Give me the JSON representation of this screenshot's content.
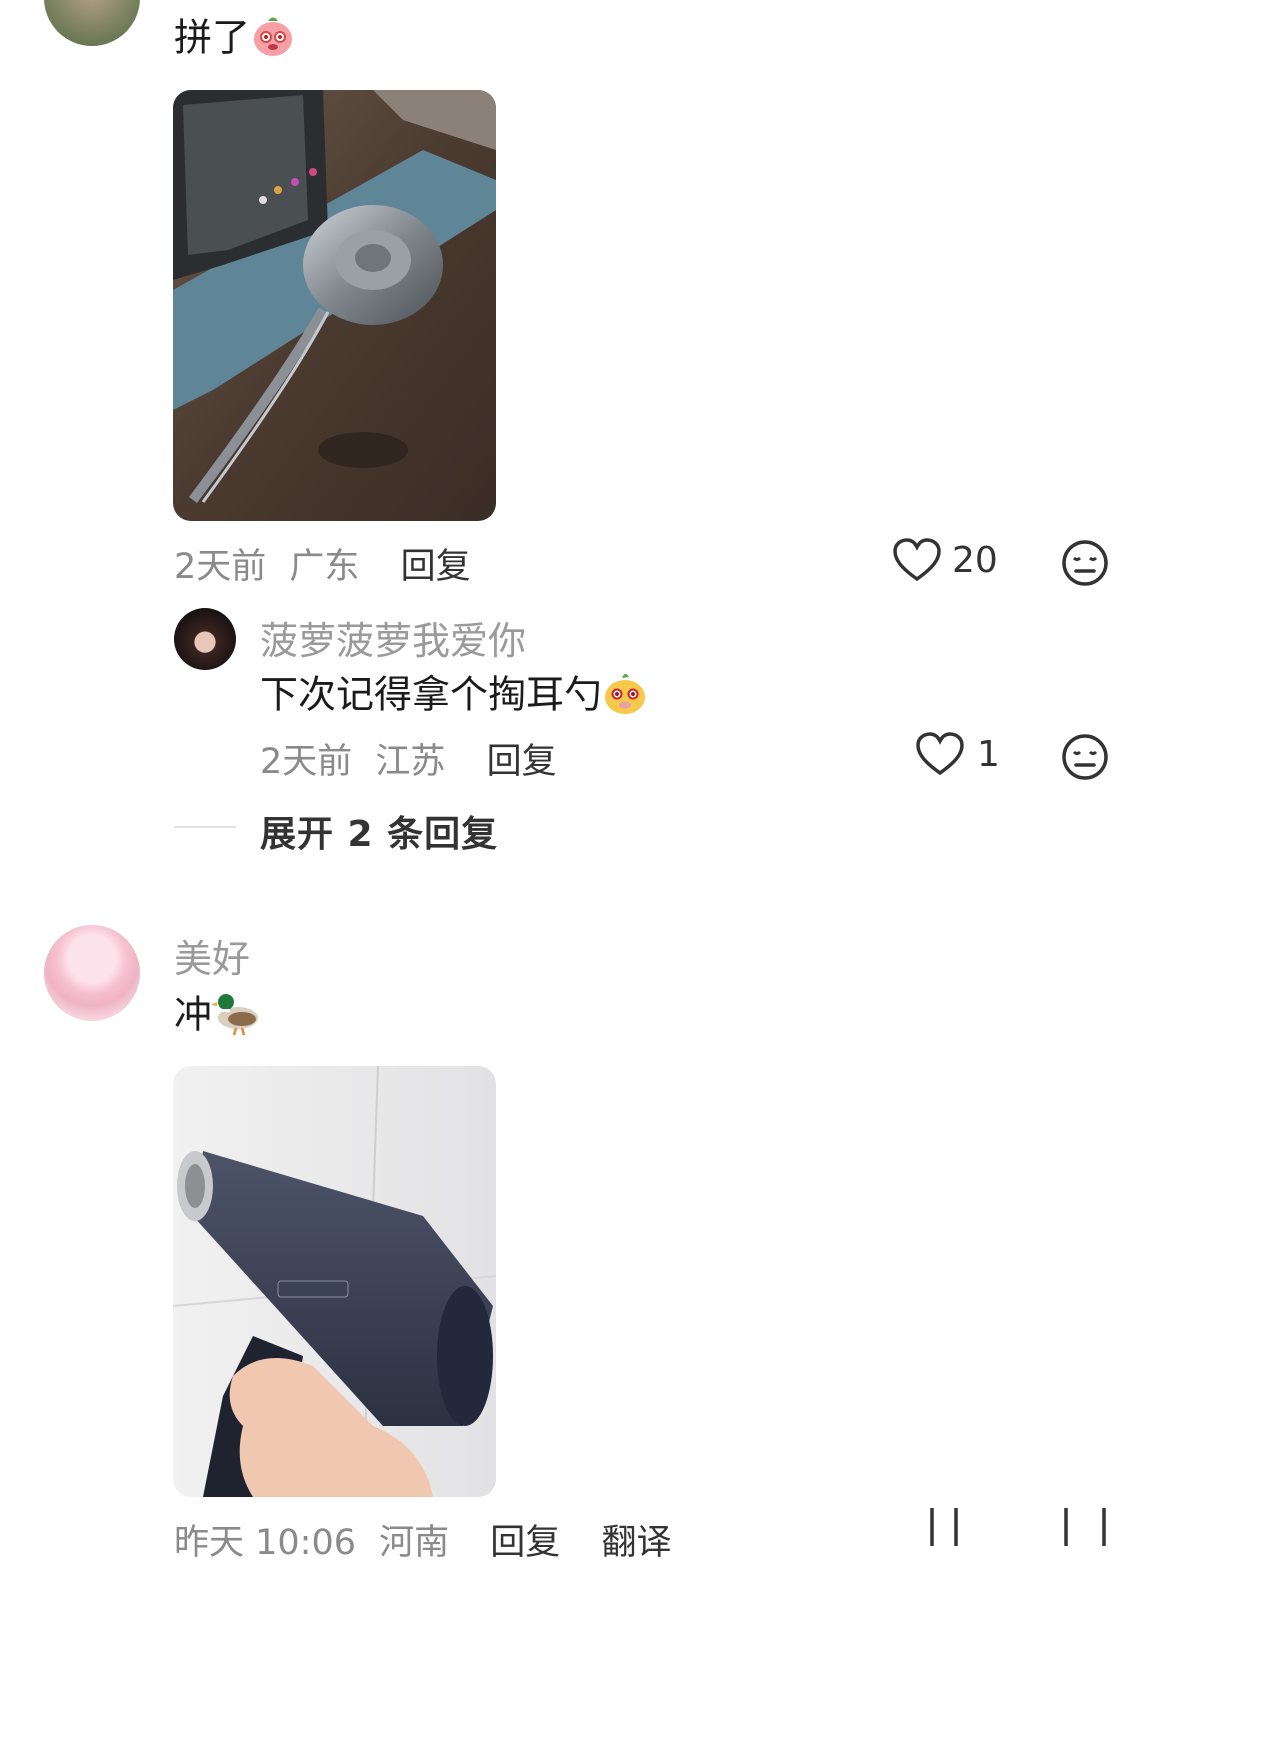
{
  "comments": [
    {
      "text": "拼了",
      "emoji": "pink-peach-emoji",
      "meta": {
        "time": "2天前",
        "location": "广东",
        "reply": "回复"
      },
      "likes": "20"
    },
    {
      "username": "美好",
      "text": "冲",
      "emoji": "duck-emoji",
      "meta": {
        "time": "昨天 10:06",
        "location": "河南",
        "reply": "回复",
        "translate": "翻译"
      }
    }
  ],
  "reply": {
    "username": "菠萝菠萝我爱你",
    "text": "下次记得拿个掏耳勺",
    "emoji": "yellow-pear-emoji",
    "meta": {
      "time": "2天前",
      "location": "江苏",
      "reply": "回复"
    },
    "likes": "1"
  },
  "expand_label": "展开 2 条回复",
  "colors": {
    "meta": "#8a8a8a",
    "text": "#1b1b1b",
    "username": "#9a9a9a"
  }
}
